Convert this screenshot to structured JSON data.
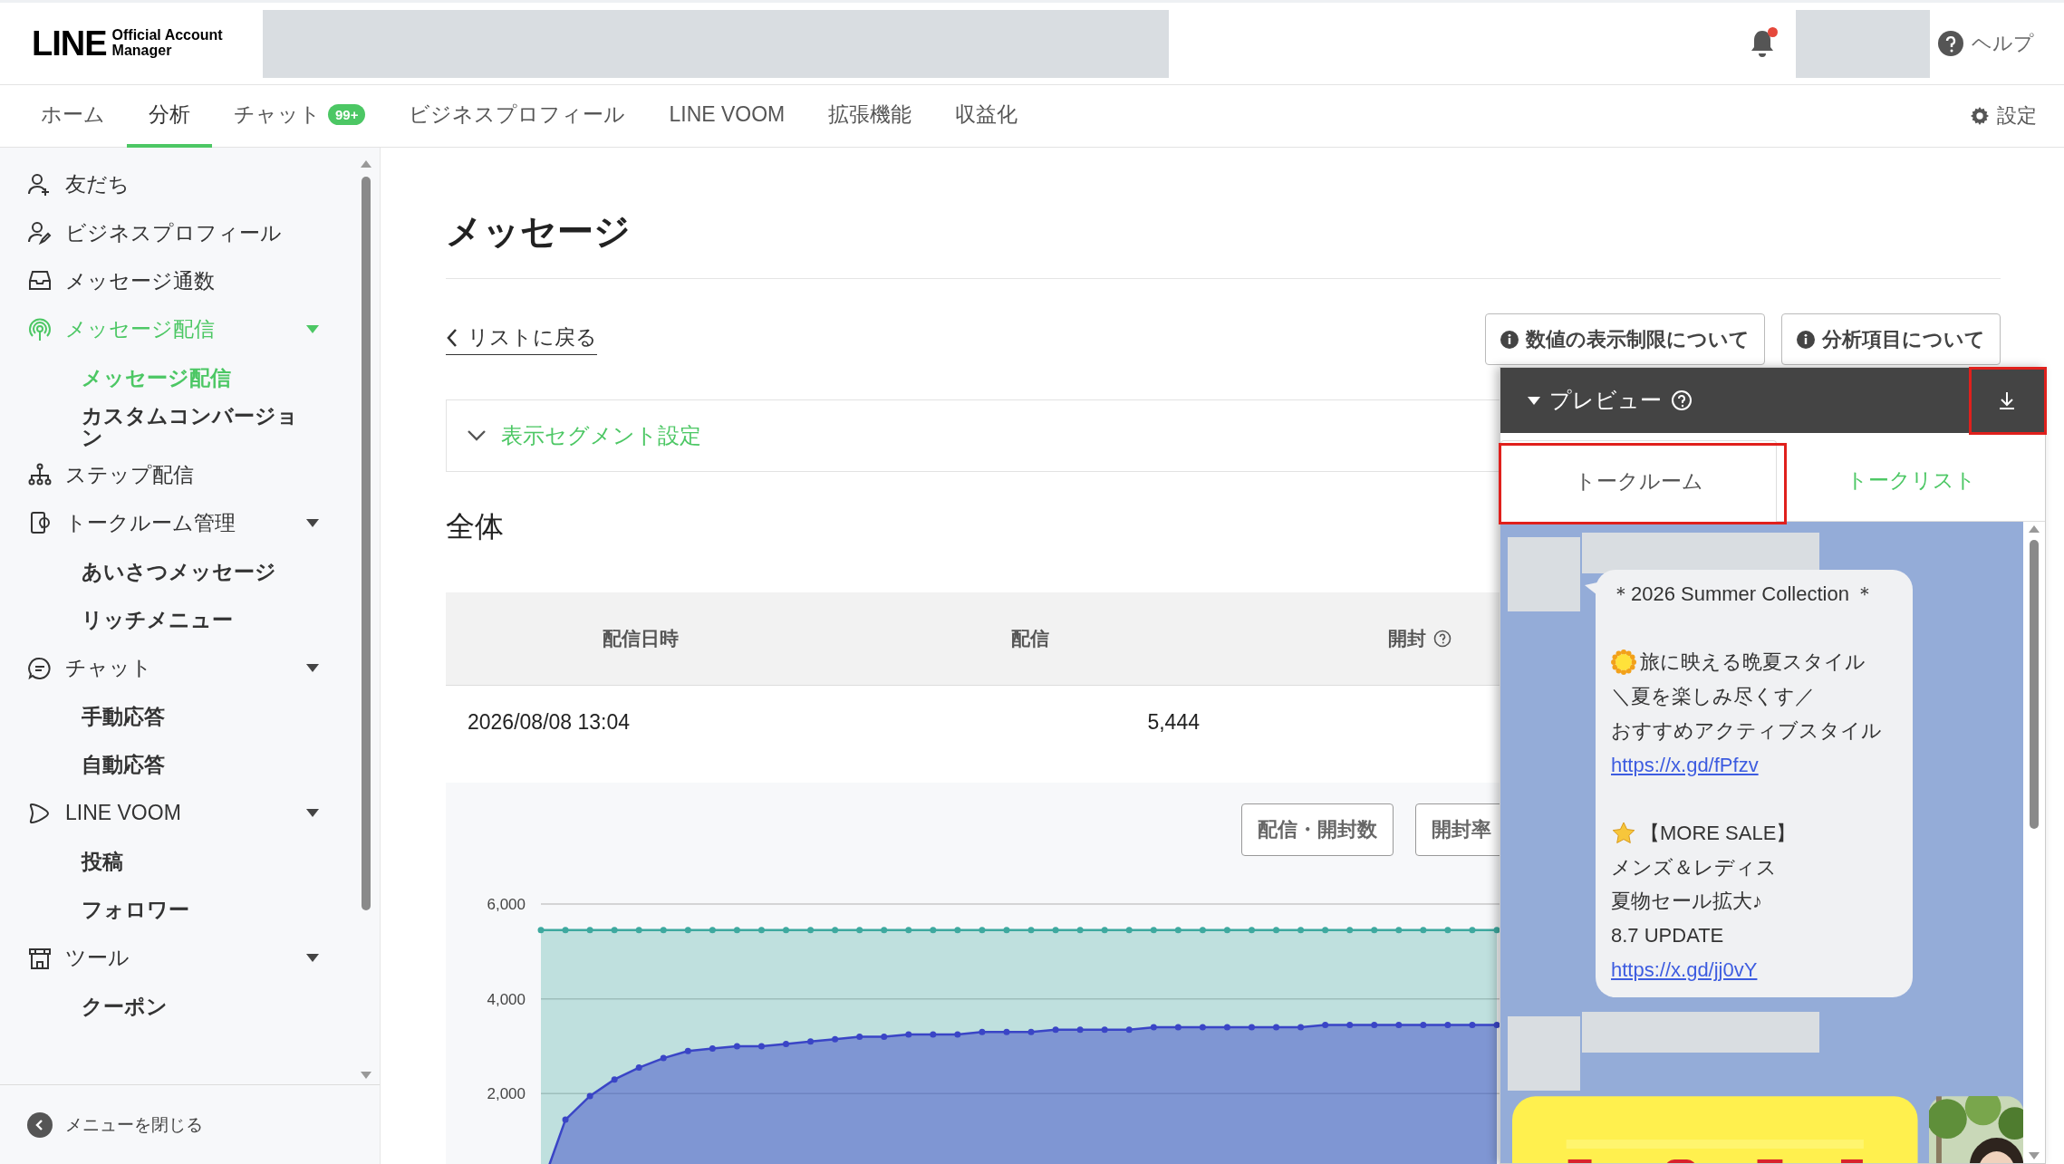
{
  "header": {
    "logo": {
      "wordmark": "LINE",
      "subtitle_1": "Official Account",
      "subtitle_2": "Manager"
    },
    "notification_unread": true,
    "help": "ヘルプ"
  },
  "nav": {
    "tabs": [
      {
        "label": "ホーム",
        "selected": false
      },
      {
        "label": "分析",
        "selected": true
      },
      {
        "label": "チャット",
        "selected": false,
        "badge": "99+"
      },
      {
        "label": "ビジネスプロフィール",
        "selected": false
      },
      {
        "label": "LINE VOOM",
        "selected": false
      },
      {
        "label": "拡張機能",
        "selected": false
      },
      {
        "label": "収益化",
        "selected": false
      }
    ],
    "settings": "設定"
  },
  "sidebar": {
    "items": [
      {
        "label": "友だち",
        "selected": false
      },
      {
        "label": "ビジネスプロフィール",
        "selected": false
      },
      {
        "label": "メッセージ通数",
        "selected": false
      },
      {
        "label": "メッセージ配信",
        "selected": true,
        "expanded": true,
        "children": [
          {
            "label": "メッセージ配信",
            "selected": true
          },
          {
            "label": "カスタムコンバージョン",
            "selected": false
          }
        ]
      },
      {
        "label": "ステップ配信",
        "selected": false
      },
      {
        "label": "トークルーム管理",
        "selected": false,
        "expanded": true,
        "children": [
          {
            "label": "あいさつメッセージ",
            "selected": false
          },
          {
            "label": "リッチメニュー",
            "selected": false
          }
        ]
      },
      {
        "label": "チャット",
        "selected": false,
        "expanded": true,
        "children": [
          {
            "label": "手動応答",
            "selected": false
          },
          {
            "label": "自動応答",
            "selected": false
          }
        ]
      },
      {
        "label": "LINE VOOM",
        "selected": false,
        "expanded": true,
        "children": [
          {
            "label": "投稿",
            "selected": false
          },
          {
            "label": "フォロワー",
            "selected": false
          }
        ]
      },
      {
        "label": "ツール",
        "selected": false,
        "expanded": true,
        "children": [
          {
            "label": "クーポン",
            "selected": false
          }
        ]
      }
    ],
    "collapse": "メニューを閉じる"
  },
  "main": {
    "title": "メッセージ",
    "back_link": "リストに戻る",
    "info_buttons": [
      "数値の表示制限について",
      "分析項目について"
    ],
    "segment": "表示セグメント設定",
    "section_title": "全体",
    "table": {
      "columns": [
        {
          "label": "配信日時",
          "help": false
        },
        {
          "label": "配信",
          "help": false
        },
        {
          "label": "開封",
          "help": true
        }
      ],
      "rows": [
        [
          "2026/08/08 13:04",
          "5,444"
        ]
      ]
    },
    "chart_buttons": [
      "配信・開封数",
      "開封率"
    ],
    "chart_data": {
      "type": "area",
      "ylim": [
        0,
        6000
      ],
      "yticks": [
        {
          "value": 2000,
          "label": "2,000"
        },
        {
          "value": 4000,
          "label": "4,000"
        },
        {
          "value": 6000,
          "label": "6,000"
        }
      ],
      "series": [
        {
          "color": "#3ea99f",
          "values": [
            5450,
            5450,
            5450,
            5450,
            5450,
            5450,
            5450,
            5450,
            5450,
            5450,
            5450,
            5450,
            5450,
            5450,
            5450,
            5450,
            5450,
            5450,
            5450,
            5450,
            5450,
            5450,
            5450,
            5450,
            5450,
            5450,
            5450,
            5450,
            5450,
            5450,
            5450,
            5450,
            5450,
            5450,
            5450,
            5450,
            5450,
            5450,
            5450,
            5450
          ]
        },
        {
          "color": "#3a45c6",
          "values": [
            0,
            1450,
            1950,
            2300,
            2550,
            2750,
            2900,
            2950,
            3000,
            3000,
            3050,
            3100,
            3150,
            3200,
            3200,
            3250,
            3250,
            3250,
            3300,
            3300,
            3300,
            3350,
            3350,
            3350,
            3350,
            3400,
            3400,
            3400,
            3400,
            3400,
            3400,
            3400,
            3450,
            3450,
            3450,
            3450,
            3450,
            3450,
            3450,
            3450
          ]
        }
      ]
    }
  },
  "preview": {
    "title": "プレビュー",
    "download_highlighted": true,
    "tabs": [
      {
        "label": "トークルーム",
        "selected": true,
        "highlighted": true
      },
      {
        "label": "トークリスト",
        "selected": false,
        "highlighted": false
      }
    ],
    "messages": [
      {
        "kind": "text",
        "lines": [
          {
            "kind": "text",
            "text": "＊2026 Summer Collection ＊"
          },
          {
            "kind": "gap"
          },
          {
            "kind": "sun",
            "text": "旅に映える晩夏スタイル"
          },
          {
            "kind": "text",
            "text": "＼夏を楽しみ尽くす／"
          },
          {
            "kind": "text",
            "text": "おすすめアクティブスタイル"
          },
          {
            "kind": "link",
            "text": "https://x.gd/fPfzv"
          },
          {
            "kind": "gap"
          },
          {
            "kind": "star",
            "text": "【MORE SALE】"
          },
          {
            "kind": "text",
            "text": "メンズ＆レディス"
          },
          {
            "kind": "text",
            "text": "夏物セール拡大♪"
          },
          {
            "kind": "text",
            "text": "8.7 UPDATE"
          },
          {
            "kind": "link",
            "text": "https://x.gd/jj0vY"
          }
        ]
      },
      {
        "kind": "picture"
      }
    ]
  }
}
